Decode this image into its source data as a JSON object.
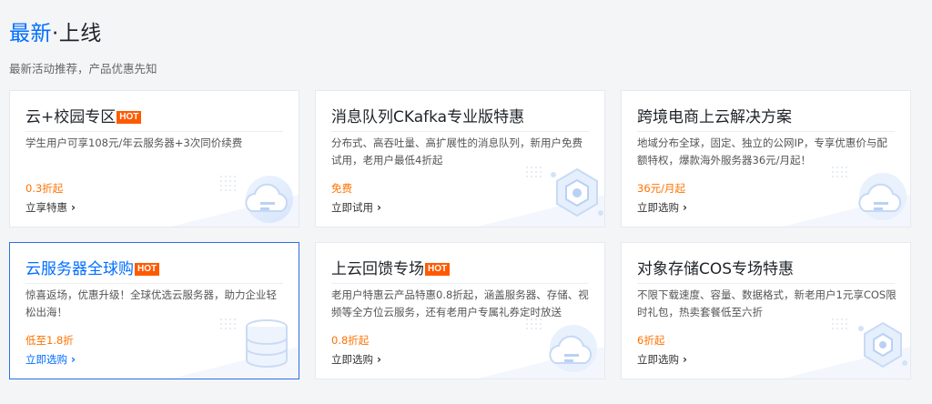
{
  "header": {
    "title_accent": "最新",
    "title_rest": "·上线",
    "subtitle": "最新活动推荐，产品优惠先知"
  },
  "cards": [
    {
      "title": "云+校园专区",
      "hot": "HOT",
      "desc": "学生用户可享108元/年云服务器+3次同价续费",
      "price": "0.3折起",
      "link": "立享特惠",
      "icon": "cloud-icon"
    },
    {
      "title": "消息队列CKafka专业版特惠",
      "hot": "",
      "desc": "分布式、高吞吐量、高扩展性的消息队列，新用户免费试用，老用户最低4折起",
      "price": "免费",
      "link": "立即试用",
      "icon": "hexagon-icon"
    },
    {
      "title": "跨境电商上云解决方案",
      "hot": "",
      "desc": "地域分布全球，固定、独立的公网IP，专享优惠价与配额特权，爆款海外服务器36元/月起！",
      "price": "36元/月起",
      "link": "立即选购",
      "icon": "cloud-icon"
    },
    {
      "title": "云服务器全球购",
      "hot": "HOT",
      "desc": "惊喜返场，优惠升级！全球优选云服务器，助力企业轻松出海！",
      "price": "低至1.8折",
      "link": "立即选购",
      "icon": "database-icon"
    },
    {
      "title": "上云回馈专场",
      "hot": "HOT",
      "desc": "老用户特惠云产品特惠0.8折起，涵盖服务器、存储、视频等全方位云服务，还有老用户专属礼券定时放送",
      "price": "0.8折起",
      "link": "立即选购",
      "icon": "cloud-icon"
    },
    {
      "title": "对象存储COS专场特惠",
      "hot": "",
      "desc": "不限下载速度、容量、数据格式，新老用户1元享COS限时礼包，热卖套餐低至六折",
      "price": "6折起",
      "link": "立即选购",
      "icon": "hexagon-icon"
    }
  ],
  "colors": {
    "accent": "#006eff",
    "price": "#ff7200",
    "hot_badge": "#ff5a00"
  }
}
